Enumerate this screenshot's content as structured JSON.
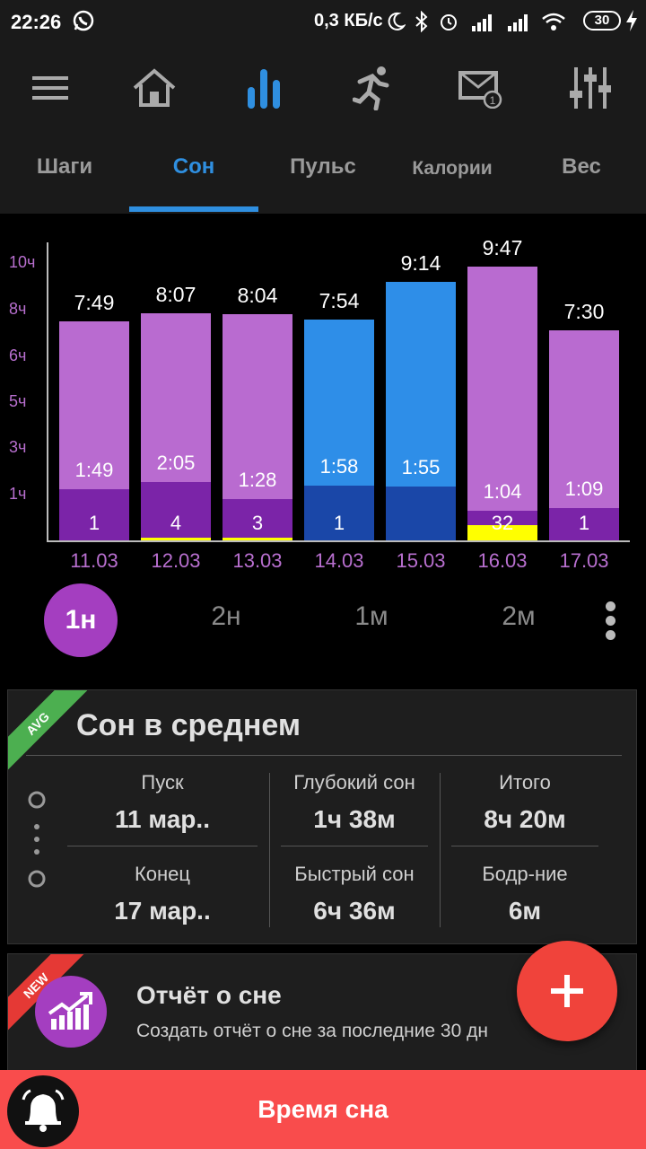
{
  "status": {
    "time": "22:26",
    "speed": "0,3 КБ/с",
    "battery": "30",
    "icons": [
      "whatsapp-icon",
      "moon-icon",
      "bluetooth-icon",
      "alarm-icon",
      "signal-icon",
      "signal-icon",
      "wifi-icon",
      "battery-icon",
      "charging-icon"
    ]
  },
  "nav": {
    "icons": [
      "menu-icon",
      "home-icon",
      "chart-icon",
      "running-icon",
      "mail-icon",
      "equalizer-icon"
    ],
    "active_color": "#2f8fe0"
  },
  "tabs": [
    "Шаги",
    "Сон",
    "Пульс",
    "Калории",
    "Вес"
  ],
  "chart_data": {
    "type": "bar",
    "categories": [
      "11.03",
      "12.03",
      "13.03",
      "14.03",
      "15.03",
      "16.03",
      "17.03"
    ],
    "y_tick_labels": [
      "10ч",
      "8ч",
      "6ч",
      "5ч",
      "3ч",
      "1ч"
    ],
    "totals": [
      "7:49",
      "8:07",
      "8:04",
      "7:54",
      "9:14",
      "9:47",
      "7:30"
    ],
    "total_hours": [
      7.82,
      8.12,
      8.07,
      7.9,
      9.23,
      9.78,
      7.5
    ],
    "deep_labels": [
      "1:49",
      "2:05",
      "1:28",
      "1:58",
      "1:55",
      "1:04",
      "1:09"
    ],
    "deep_hours": [
      1.82,
      2.08,
      1.47,
      1.97,
      1.92,
      1.07,
      1.15
    ],
    "awake_minutes": [
      1,
      4,
      3,
      1,
      null,
      32,
      1
    ],
    "awake_labels": [
      "1",
      "4",
      "3",
      "1",
      "",
      "32",
      "1"
    ],
    "colors": [
      "purple",
      "purple",
      "purple",
      "blue",
      "blue",
      "purple",
      "purple"
    ],
    "ylim": [
      0,
      10.5
    ]
  },
  "periods": {
    "active": "1н",
    "items": [
      "2н",
      "1м",
      "2м"
    ]
  },
  "avg": {
    "badge": "AVG",
    "title": "Сон в среднем",
    "start_label": "Пуск",
    "start_value": "11 мар..",
    "end_label": "Конец",
    "end_value": "17 мар..",
    "deep_label": "Глубокий сон",
    "deep_value": "1ч 38м",
    "light_label": "Быстрый сон",
    "light_value": "6ч 36м",
    "total_label": "Итого",
    "total_value": "8ч 20м",
    "awake_label": "Бодр-ние",
    "awake_value": "6м"
  },
  "report": {
    "badge": "NEW",
    "title": "Отчёт о сне",
    "subtitle": "Создать отчёт о сне за последние 30 дн"
  },
  "bottom": {
    "label": "Время сна"
  }
}
